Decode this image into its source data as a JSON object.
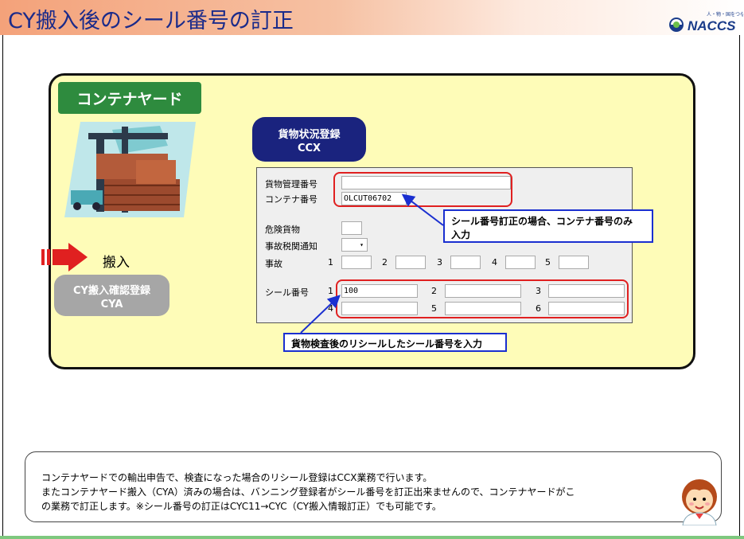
{
  "header": {
    "title": "CY搬入後のシール番号の訂正",
    "logo_text": "NACCS",
    "logo_tagline": "人・物・国をつなぐ"
  },
  "yard": {
    "label": "コンテナヤード",
    "ccx_button": {
      "line1": "貨物状況登録",
      "line2": "CCX"
    },
    "hannyu_label": "搬入",
    "cya_button": {
      "line1": "CY搬入確認登録",
      "line2": "CYA"
    }
  },
  "form": {
    "cargo_no_label": "貨物管理番号",
    "cargo_no_value": "",
    "container_no_label": "コンテナ番号",
    "container_no_value": "OLCUT06702",
    "dangerous_label": "危険貨物",
    "dangerous_value": "",
    "accident_notice_label": "事故税関通知",
    "accident_notice_value": "",
    "accident_label": "事故",
    "accident_fields": [
      {
        "num": "1",
        "value": ""
      },
      {
        "num": "2",
        "value": ""
      },
      {
        "num": "3",
        "value": ""
      },
      {
        "num": "4",
        "value": ""
      },
      {
        "num": "5",
        "value": ""
      }
    ],
    "seal_label": "シール番号",
    "seal_fields": [
      {
        "num": "1",
        "value": "100"
      },
      {
        "num": "2",
        "value": ""
      },
      {
        "num": "3",
        "value": ""
      },
      {
        "num": "4",
        "value": ""
      },
      {
        "num": "5",
        "value": ""
      },
      {
        "num": "6",
        "value": ""
      }
    ]
  },
  "callouts": {
    "container_note_line1": "シール番号訂正の場合、コンテナ番号のみ",
    "container_note_line2": "入力",
    "seal_note": "貨物検査後のリシールしたシール番号を入力"
  },
  "note": {
    "line1": "コンテナヤードでの輸出申告で、検査になった場合のリシール登録はCCX業務で行います。",
    "line2": "またコンテナヤード搬入（CYA）済みの場合は、バンニング登録者がシール番号を訂正出来ませんので、コンテナヤードがこ",
    "line3": "の業務で訂正します。※シール番号の訂正はCYC11→CYC（CY搬入情報訂正）でも可能です。"
  },
  "colors": {
    "title": "#1b2b8a",
    "yard_bg": "#fefcb8",
    "label_green": "#2e8b3e",
    "ccx_navy": "#1a237e",
    "cya_gray": "#a6a6a6",
    "highlight_red": "#e02020",
    "callout_blue": "#1a2fd0"
  }
}
